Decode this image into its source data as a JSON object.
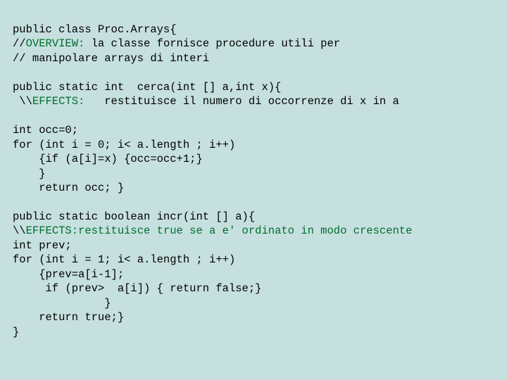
{
  "code": {
    "l1": "public class Proc.Arrays{",
    "l2a": "//",
    "l2b": "OVERVIEW:",
    "l2c": " la classe fornisce procedure utili per",
    "l3": "// manipolare arrays di interi",
    "l4": "",
    "l5": "public static int  cerca(int [] a,int x){",
    "l6a": " \\\\",
    "l6b": "EFFECTS:",
    "l6c": "   restituisce il numero di occorrenze di x in a",
    "l7": "",
    "l8": "int occ=0;",
    "l9": "for (int i = 0; i< a.length ; i++)",
    "l10": "    {if (a[i]=x) {occ=occ+1;}",
    "l11": "    }",
    "l12": "    return occ; }",
    "l13": "",
    "l14": "public static boolean incr(int [] a){",
    "l15a": "\\\\",
    "l15b": "EFFECTS:restituisce true se a e' ordinato in modo crescente",
    "l16": "int prev;",
    "l17": "for (int i = 1; i< a.length ; i++)",
    "l18": "    {prev=a[i-1];",
    "l19": "     if (prev>  a[i]) { return false;}",
    "l20": "              }",
    "l21": "    return true;}",
    "l22": "}"
  }
}
